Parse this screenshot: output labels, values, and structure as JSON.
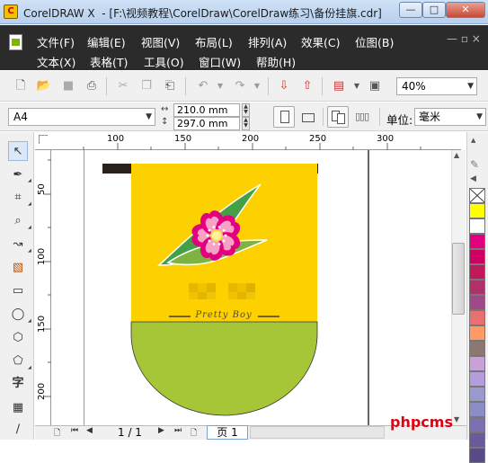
{
  "window": {
    "title": "CorelDRAW X  - [F:\\视频教程\\CorelDraw\\CorelDraw练习\\备份挂旗.cdr]",
    "min_label": "—",
    "restore_label": "□",
    "close_label": "✕"
  },
  "menu": {
    "row1": [
      "文件(F)",
      "编辑(E)",
      "视图(V)",
      "布局(L)",
      "排列(A)",
      "效果(C)",
      "位图(B)"
    ],
    "row2": [
      "文本(X)",
      "表格(T)",
      "工具(O)",
      "窗口(W)",
      "帮助(H)"
    ],
    "mdi_controls": "— ▫ ×"
  },
  "toolbar": {
    "zoom": "40%"
  },
  "property_bar": {
    "page_size": "A4",
    "width": "210.0 mm",
    "height": "297.0 mm",
    "units_label": "单位:",
    "units": "毫米"
  },
  "rulers": {
    "h_ticks": [
      "100",
      "150",
      "200",
      "250",
      "300"
    ],
    "v_ticks": [
      "50",
      "100",
      "150",
      "200"
    ]
  },
  "artwork": {
    "banner_text": "Pretty Boy",
    "top_color": "#fdd000",
    "bottom_color": "#a6c637",
    "rod_color": "#2a201c",
    "petal_outer": "#e3007f",
    "petal_inner": "#f7a1c4"
  },
  "status": {
    "page_count": "1 / 1",
    "page_tab": "页 1"
  },
  "palette": [
    "none",
    "#ffff00",
    "#ffffff",
    "#e3007f",
    "#d00060",
    "#c2185b",
    "#b0306a",
    "#a0488a",
    "#e87070",
    "#ff9966",
    "#8c7870",
    "#c9a0dc",
    "#b39ddb",
    "#9999cc",
    "#8c8cc8",
    "#7e70b0",
    "#6a5a9a",
    "#5a4a8a"
  ],
  "watermark": "phpcms"
}
